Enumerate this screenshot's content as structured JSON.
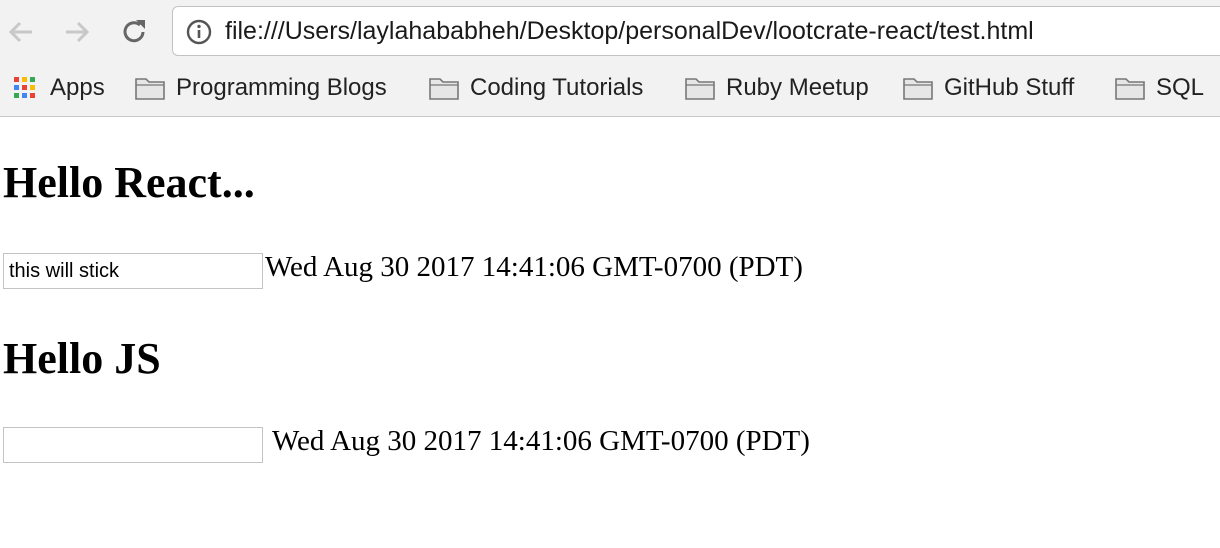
{
  "browser": {
    "url": "file:///Users/laylahababheh/Desktop/personalDev/lootcrate-react/test.html",
    "bookmarks": [
      "Apps",
      "Programming Blogs",
      "Coding Tutorials",
      "Ruby Meetup",
      "GitHub Stuff",
      "SQL"
    ]
  },
  "page": {
    "react": {
      "heading": "Hello React...",
      "input_value": "this will stick",
      "date": "Wed Aug 30 2017 14:41:06 GMT-0700 (PDT)"
    },
    "js": {
      "heading": "Hello JS",
      "input_value": "",
      "date": "Wed Aug 30 2017 14:41:06 GMT-0700 (PDT)"
    }
  }
}
